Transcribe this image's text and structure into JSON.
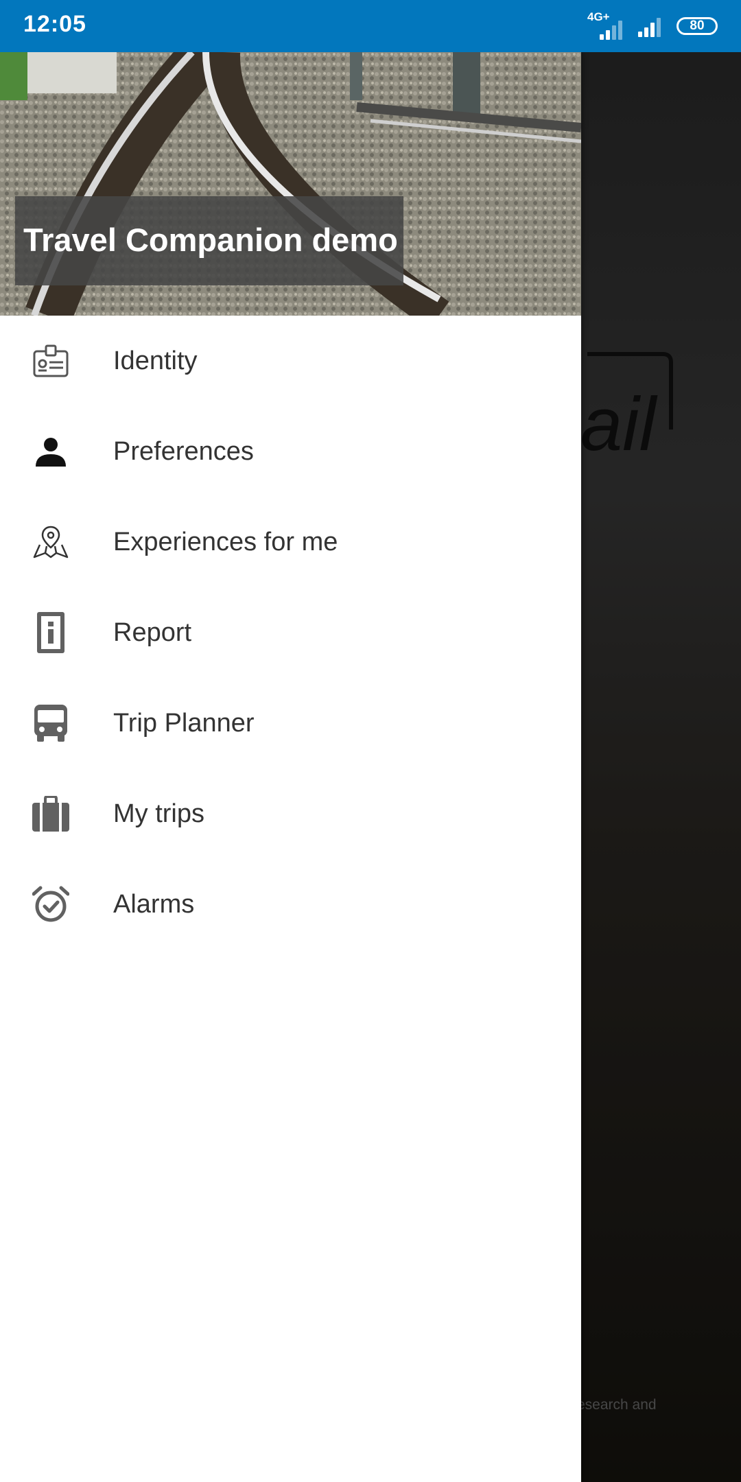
{
  "status_bar": {
    "time": "12:05",
    "network": "4G+",
    "battery": "80",
    "bg_color": "#0277bd"
  },
  "drawer": {
    "title": "Travel Companion demo",
    "items": [
      {
        "label": "Identity",
        "icon": "id-badge-icon"
      },
      {
        "label": "Preferences",
        "icon": "person-icon"
      },
      {
        "label": "Experiences for me",
        "icon": "map-pin-icon"
      },
      {
        "label": "Report",
        "icon": "info-icon"
      },
      {
        "label": "Trip Planner",
        "icon": "bus-icon"
      },
      {
        "label": "My trips",
        "icon": "suitcase-icon"
      },
      {
        "label": "Alarms",
        "icon": "alarm-check-icon"
      }
    ]
  },
  "background": {
    "footer_text": "research and"
  }
}
